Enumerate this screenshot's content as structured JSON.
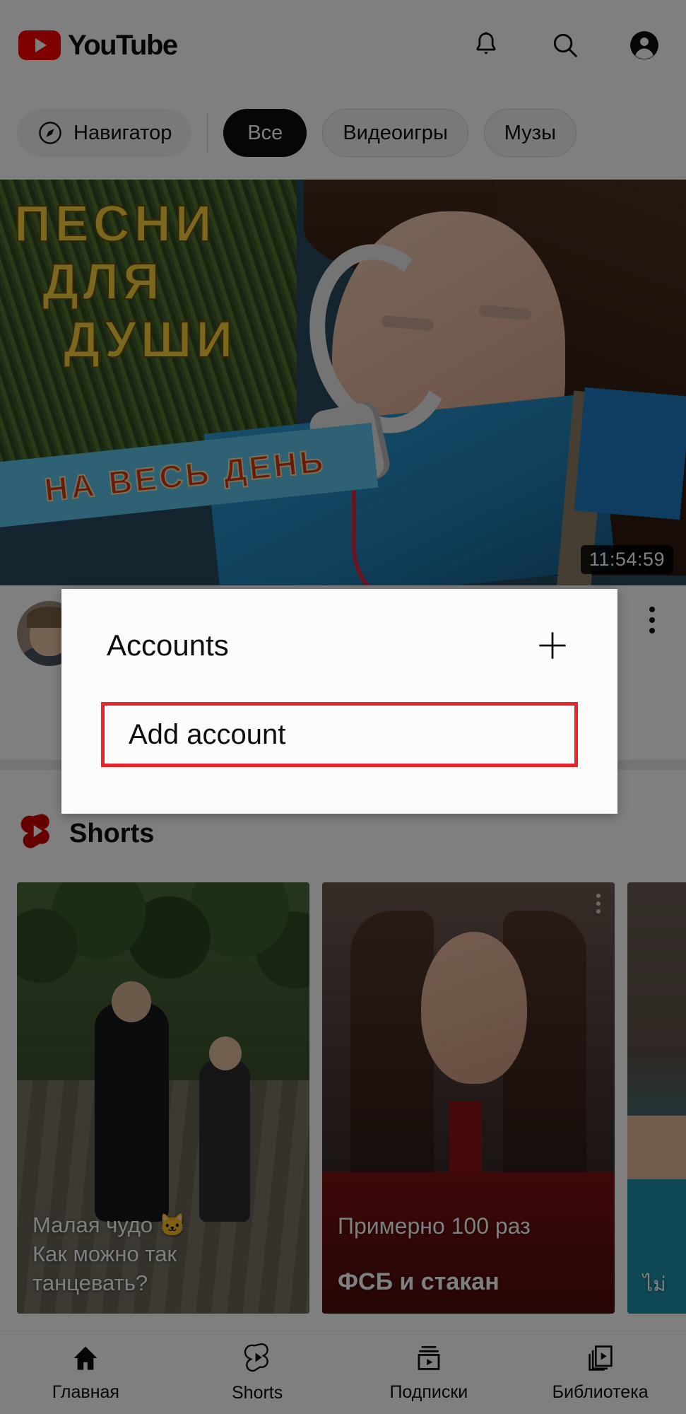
{
  "app": {
    "brand_name": "YouTube",
    "brand_color": "#ff0000"
  },
  "appbar": {
    "notifications_label": "notifications-bell",
    "search_label": "search",
    "account_label": "account-avatar"
  },
  "chips": {
    "navigator": "Навигатор",
    "items": [
      {
        "label": "Все",
        "selected": true
      },
      {
        "label": "Видеоигры",
        "selected": false
      },
      {
        "label": "Музы",
        "selected": false
      }
    ]
  },
  "hero": {
    "title_line1": "ПЕСНИ",
    "title_line2": "ДЛЯ",
    "title_line3": "ДУШИ",
    "banner_text": "НА ВЕСЬ ДЕНЬ",
    "duration": "11:54:59"
  },
  "video_info": {
    "title": "",
    "meta": "",
    "menu_label": "more-options"
  },
  "shorts": {
    "section_title": "Shorts",
    "cards": [
      {
        "caption_line1": "Малая чудо 🐱",
        "caption_line2": "Как можно так",
        "caption_line3": "танцевать?"
      },
      {
        "caption_line1": "Примерно 100 раз",
        "caption_line2": "ФСБ и стакан"
      },
      {
        "caption_line1": "ไม่"
      }
    ]
  },
  "bottom_nav": {
    "items": [
      {
        "label": "Главная",
        "icon": "home-icon",
        "active": true
      },
      {
        "label": "Shorts",
        "icon": "shorts-icon",
        "active": false
      },
      {
        "label": "Подписки",
        "icon": "subscriptions-icon",
        "active": false
      },
      {
        "label": "Библиотека",
        "icon": "library-icon",
        "active": false
      }
    ]
  },
  "modal": {
    "title": "Accounts",
    "add_icon": "plus-icon",
    "add_account_label": "Add account",
    "highlight_color": "#e8252a"
  }
}
